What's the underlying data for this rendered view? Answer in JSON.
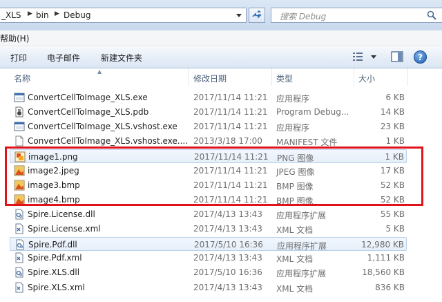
{
  "address": {
    "crumbs": [
      "_XLS",
      "bin",
      "Debug"
    ],
    "search_placeholder": "搜索 Debug"
  },
  "menu": {
    "help": "帮助(H)"
  },
  "toolbar": {
    "print": "打印",
    "email": "电子邮件",
    "new_folder": "新建文件夹"
  },
  "columns": {
    "name": "名称",
    "modified": "修改日期",
    "type": "类型",
    "size": "大小"
  },
  "colors": {
    "annotation": "#e0121b",
    "highlight_border": "#b9d1ee"
  },
  "files": [
    {
      "name": "ConvertCellToImage_XLS.exe",
      "date": "2017/11/14 11:21",
      "type": "应用程序",
      "size": "6 KB",
      "icon": "exe-icon"
    },
    {
      "name": "ConvertCellToImage_XLS.pdb",
      "date": "2017/11/14 11:21",
      "type": "Program Debug...",
      "size": "14 KB",
      "icon": "pdb-icon"
    },
    {
      "name": "ConvertCellToImage_XLS.vshost.exe",
      "date": "2017/11/14 11:21",
      "type": "应用程序",
      "size": "23 KB",
      "icon": "exe-icon"
    },
    {
      "name": "ConvertCellToImage_XLS.vshost.exe....",
      "date": "2013/3/18 17:00",
      "type": "MANIFEST 文件",
      "size": "1 KB",
      "icon": "file-icon"
    },
    {
      "name": "image1.png",
      "date": "2017/11/14 11:21",
      "type": "PNG 图像",
      "size": "1 KB",
      "icon": "png-icon"
    },
    {
      "name": "image2.jpeg",
      "date": "2017/11/14 11:21",
      "type": "JPEG 图像",
      "size": "17 KB",
      "icon": "image-icon"
    },
    {
      "name": "image3.bmp",
      "date": "2017/11/14 11:21",
      "type": "BMP 图像",
      "size": "52 KB",
      "icon": "image-icon"
    },
    {
      "name": "image4.bmp",
      "date": "2017/11/14 11:21",
      "type": "BMP 图像",
      "size": "52 KB",
      "icon": "image-icon"
    },
    {
      "name": "Spire.License.dll",
      "date": "2017/4/13 13:43",
      "type": "应用程序扩展",
      "size": "55 KB",
      "icon": "dll-icon"
    },
    {
      "name": "Spire.License.xml",
      "date": "2017/4/13 13:43",
      "type": "XML 文档",
      "size": "5 KB",
      "icon": "xml-icon"
    },
    {
      "name": "Spire.Pdf.dll",
      "date": "2017/5/10 16:36",
      "type": "应用程序扩展",
      "size": "12,980 KB",
      "icon": "dll-icon"
    },
    {
      "name": "Spire.Pdf.xml",
      "date": "2017/4/13 13:43",
      "type": "XML 文档",
      "size": "1,111 KB",
      "icon": "xml-icon"
    },
    {
      "name": "Spire.XLS.dll",
      "date": "2017/5/10 16:36",
      "type": "应用程序扩展",
      "size": "18,560 KB",
      "icon": "dll-icon"
    },
    {
      "name": "Spire.XLS.xml",
      "date": "2017/4/13 13:43",
      "type": "XML 文档",
      "size": "836 KB",
      "icon": "xml-icon"
    }
  ]
}
